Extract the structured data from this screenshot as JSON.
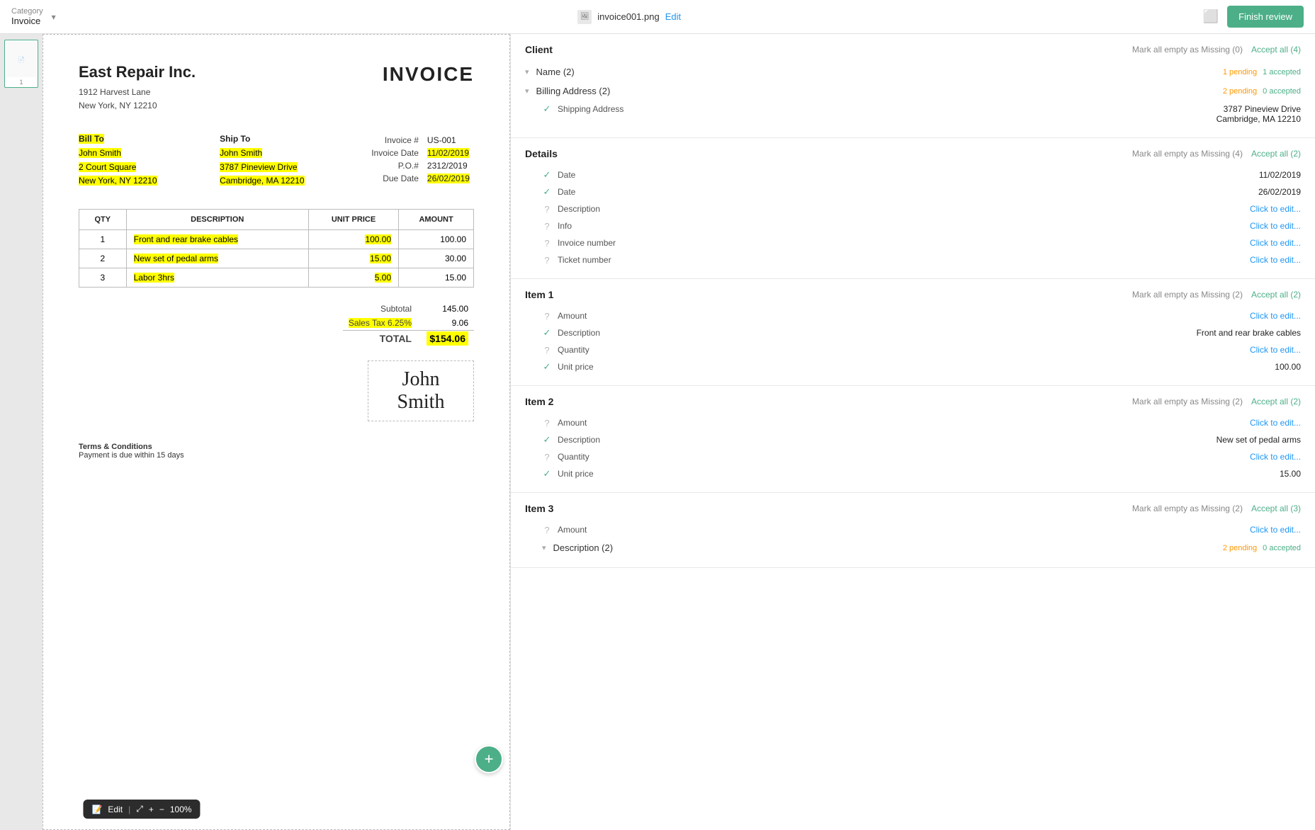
{
  "topbar": {
    "category_label": "Category",
    "category_value": "Invoice",
    "filename": "invoice001.png",
    "edit_label": "Edit",
    "finish_review_label": "Finish review"
  },
  "thumbnail": {
    "page_num": "1"
  },
  "invoice": {
    "company_name": "East Repair Inc.",
    "company_address_line1": "1912 Harvest Lane",
    "company_address_line2": "New York, NY 12210",
    "title": "INVOICE",
    "bill_to_label": "Bill To",
    "bill_to_name": "John Smith",
    "bill_to_address1": "2 Court Square",
    "bill_to_address2": "New York, NY 12210",
    "ship_to_label": "Ship To",
    "ship_to_name": "John Smith",
    "ship_to_address1": "3787 Pineview Drive",
    "ship_to_address2": "Cambridge, MA 12210",
    "invoice_hash": "Invoice #",
    "invoice_num": "US-001",
    "invoice_date_label": "Invoice Date",
    "invoice_date": "11/02/2019",
    "po_label": "P.O.#",
    "po_num": "2312/2019",
    "due_date_label": "Due Date",
    "due_date": "26/02/2019",
    "table_headers": [
      "QTY",
      "DESCRIPTION",
      "UNIT PRICE",
      "AMOUNT"
    ],
    "line_items": [
      {
        "qty": "1",
        "desc": "Front and rear brake cables",
        "unit_price": "100.00",
        "amount": "100.00"
      },
      {
        "qty": "2",
        "desc": "New set of pedal arms",
        "unit_price": "15.00",
        "amount": "30.00"
      },
      {
        "qty": "3",
        "desc": "Labor 3hrs",
        "unit_price": "5.00",
        "amount": "15.00"
      }
    ],
    "subtotal_label": "Subtotal",
    "subtotal": "145.00",
    "tax_label": "Sales Tax 6.25%",
    "tax": "9.06",
    "total_label": "TOTAL",
    "total": "$154.06",
    "signature": "John Smith",
    "terms_title": "Terms & Conditions",
    "terms_text": "Payment is due within 15 days"
  },
  "zoom": {
    "expand_icon": "⤢",
    "plus_icon": "+",
    "minus_icon": "−",
    "zoom_level": "100%",
    "edit_label": "Edit"
  },
  "right_panel": {
    "client_section": {
      "title": "Client",
      "mark_missing_label": "Mark all empty as Missing (0)",
      "accept_all_label": "Accept all (4)",
      "name_group": {
        "label": "Name (2)",
        "pending": "1 pending",
        "accepted": "1 accepted"
      },
      "billing_address_group": {
        "label": "Billing Address (2)",
        "pending": "2 pending",
        "accepted": "0 accepted"
      },
      "shipping_address": {
        "label": "Shipping Address",
        "value1": "3787 Pineview Drive",
        "value2": "Cambridge, MA 12210"
      }
    },
    "details_section": {
      "title": "Details",
      "mark_missing_label": "Mark all empty as Missing (4)",
      "accept_all_label": "Accept all (2)",
      "fields": [
        {
          "label": "Date",
          "value": "11/02/2019",
          "status": "check"
        },
        {
          "label": "Date",
          "value": "26/02/2019",
          "status": "check"
        },
        {
          "label": "Description",
          "value": "Click to edit...",
          "status": "question",
          "clickable": true
        },
        {
          "label": "Info",
          "value": "Click to edit...",
          "status": "question",
          "clickable": true
        },
        {
          "label": "Invoice number",
          "value": "Click to edit...",
          "status": "question",
          "clickable": true
        },
        {
          "label": "Ticket number",
          "value": "Click to edit...",
          "status": "question",
          "clickable": true
        }
      ]
    },
    "item1_section": {
      "title": "Item 1",
      "mark_missing_label": "Mark all empty as Missing (2)",
      "accept_all_label": "Accept all (2)",
      "fields": [
        {
          "label": "Amount",
          "value": "Click to edit...",
          "status": "question",
          "clickable": true
        },
        {
          "label": "Description",
          "value": "Front and rear brake cables",
          "status": "check"
        },
        {
          "label": "Quantity",
          "value": "Click to edit...",
          "status": "question",
          "clickable": true
        },
        {
          "label": "Unit price",
          "value": "100.00",
          "status": "check"
        }
      ]
    },
    "item2_section": {
      "title": "Item 2",
      "mark_missing_label": "Mark all empty as Missing (2)",
      "accept_all_label": "Accept all (2)",
      "fields": [
        {
          "label": "Amount",
          "value": "Click to edit...",
          "status": "question",
          "clickable": true
        },
        {
          "label": "Description",
          "value": "New set of pedal arms",
          "status": "check"
        },
        {
          "label": "Quantity",
          "value": "Click to edit...",
          "status": "question",
          "clickable": true
        },
        {
          "label": "Unit price",
          "value": "15.00",
          "status": "check"
        }
      ]
    },
    "item3_section": {
      "title": "Item 3",
      "mark_missing_label": "Mark all empty as Missing (2)",
      "accept_all_label": "Accept all (3)",
      "fields": [
        {
          "label": "Amount",
          "value": "Click to edit...",
          "status": "question",
          "clickable": true
        },
        {
          "label": "Description (2)",
          "value": "",
          "status": "chevron",
          "pending": "2 pending",
          "accepted": "0 accepted"
        }
      ]
    }
  },
  "colors": {
    "accept_green": "#4caf88",
    "pending_orange": "#ff9800",
    "highlight_yellow": "#ffff00",
    "link_blue": "#2196f3"
  }
}
